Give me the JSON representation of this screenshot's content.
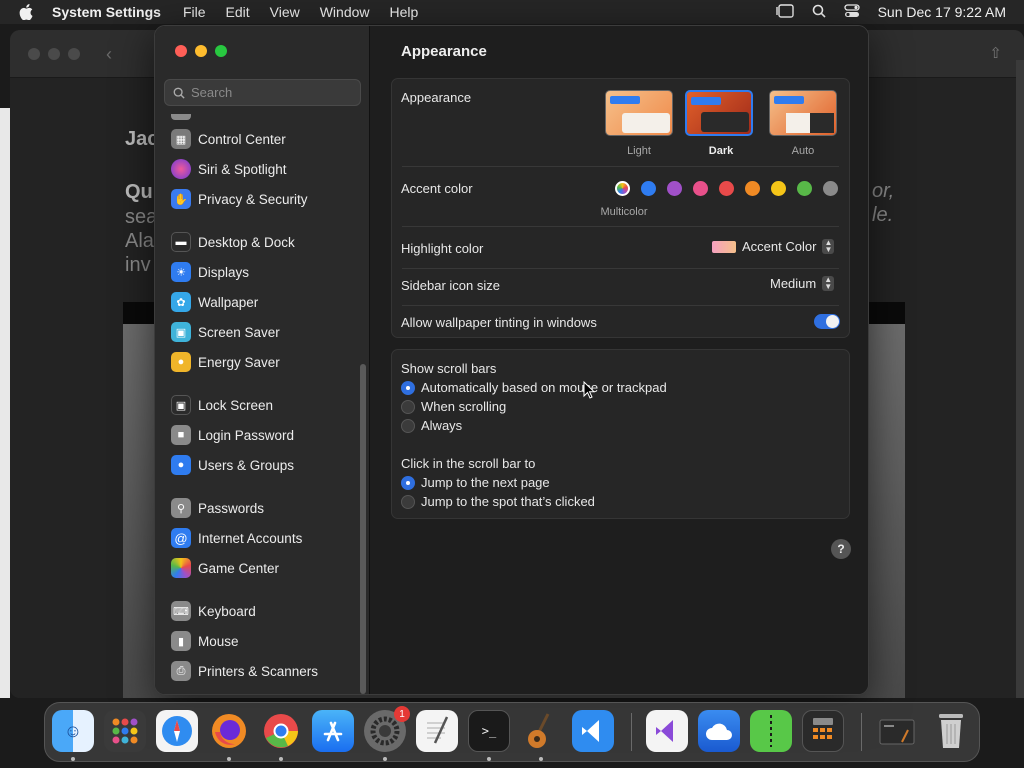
{
  "menubar": {
    "app_name": "System Settings",
    "menus": [
      "File",
      "Edit",
      "View",
      "Window",
      "Help"
    ],
    "clock": "Sun Dec 17  9:22 AM"
  },
  "background": {
    "text_lines": [
      "Jac",
      "Qui",
      "sea",
      "Ala",
      "inv",
      "or,",
      "le."
    ]
  },
  "search": {
    "placeholder": "Search"
  },
  "sidebar": {
    "items": [
      {
        "label": "Control Center",
        "icon": "control-center-icon",
        "color": "#7a7a7a"
      },
      {
        "label": "Siri & Spotlight",
        "icon": "siri-icon",
        "color": "#c23bd4"
      },
      {
        "label": "Privacy & Security",
        "icon": "hand-icon",
        "color": "#3a7bf0"
      },
      {
        "label": "Desktop & Dock",
        "icon": "dock-icon",
        "color": "#2b2b2b"
      },
      {
        "label": "Displays",
        "icon": "sun-icon",
        "color": "#2f7cf0"
      },
      {
        "label": "Wallpaper",
        "icon": "flower-icon",
        "color": "#35a7e8"
      },
      {
        "label": "Screen Saver",
        "icon": "screen-saver-icon",
        "color": "#3fb3d9"
      },
      {
        "label": "Energy Saver",
        "icon": "bulb-icon",
        "color": "#f0b52a"
      },
      {
        "label": "Lock Screen",
        "icon": "lock-screen-icon",
        "color": "#2b2b2b"
      },
      {
        "label": "Login Password",
        "icon": "lock-icon",
        "color": "#8a8a8a"
      },
      {
        "label": "Users & Groups",
        "icon": "users-icon",
        "color": "#2f7cf0"
      },
      {
        "label": "Passwords",
        "icon": "key-icon",
        "color": "#8a8a8a"
      },
      {
        "label": "Internet Accounts",
        "icon": "at-icon",
        "color": "#2f7cf0"
      },
      {
        "label": "Game Center",
        "icon": "game-center-icon",
        "color": "#e8e8e8"
      },
      {
        "label": "Keyboard",
        "icon": "keyboard-icon",
        "color": "#8a8a8a"
      },
      {
        "label": "Mouse",
        "icon": "mouse-icon",
        "color": "#8a8a8a"
      },
      {
        "label": "Printers & Scanners",
        "icon": "printer-icon",
        "color": "#8a8a8a"
      }
    ]
  },
  "main": {
    "title": "Appearance",
    "appearance": {
      "label": "Appearance",
      "options": [
        {
          "label": "Light",
          "selected": false
        },
        {
          "label": "Dark",
          "selected": true
        },
        {
          "label": "Auto",
          "selected": false
        }
      ]
    },
    "accent": {
      "label": "Accent color",
      "selected_name": "Multicolor",
      "colors": [
        "multicolor",
        "#2f7cf0",
        "#a050c8",
        "#e8508a",
        "#e84a4a",
        "#f08a24",
        "#f5c518",
        "#58b848",
        "#8a8a8a"
      ]
    },
    "highlight": {
      "label": "Highlight color",
      "value": "Accent Color"
    },
    "sidebar_icon_size": {
      "label": "Sidebar icon size",
      "value": "Medium"
    },
    "wallpaper_tinting": {
      "label": "Allow wallpaper tinting in windows",
      "on": true
    },
    "scroll_bars": {
      "label": "Show scroll bars",
      "options": [
        {
          "label": "Automatically based on mouse or trackpad",
          "selected": true
        },
        {
          "label": "When scrolling",
          "selected": false
        },
        {
          "label": "Always",
          "selected": false
        }
      ]
    },
    "click_scroll": {
      "label": "Click in the scroll bar to",
      "options": [
        {
          "label": "Jump to the next page",
          "selected": true
        },
        {
          "label": "Jump to the spot that’s clicked",
          "selected": false
        }
      ]
    },
    "help": "?"
  },
  "dock": {
    "badge_count": "1"
  }
}
